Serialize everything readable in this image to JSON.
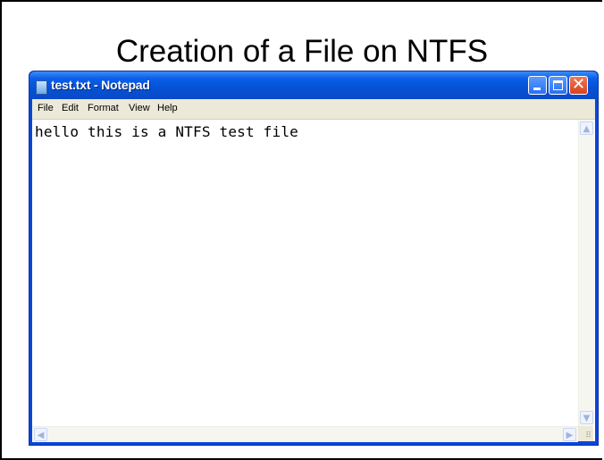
{
  "slide": {
    "title": "Creation of a File on NTFS"
  },
  "window": {
    "title": "test.txt - Notepad",
    "buttons": {
      "minimize_icon": "minimize-icon",
      "maximize_icon": "maximize-icon",
      "close_icon": "close-icon",
      "close_glyph": "✕"
    }
  },
  "menu": {
    "items": [
      "File",
      "Edit",
      "Format",
      "View",
      "Help"
    ]
  },
  "editor": {
    "content": "hello this is a NTFS test file"
  },
  "scrollbars": {
    "up_arrow": "▲",
    "down_arrow": "▼",
    "left_arrow": "◀",
    "right_arrow": "▶",
    "grip": "⠿"
  },
  "colors": {
    "titlebar": "#0a5fea",
    "close_button": "#d8431e",
    "menubar": "#ece9d8"
  }
}
